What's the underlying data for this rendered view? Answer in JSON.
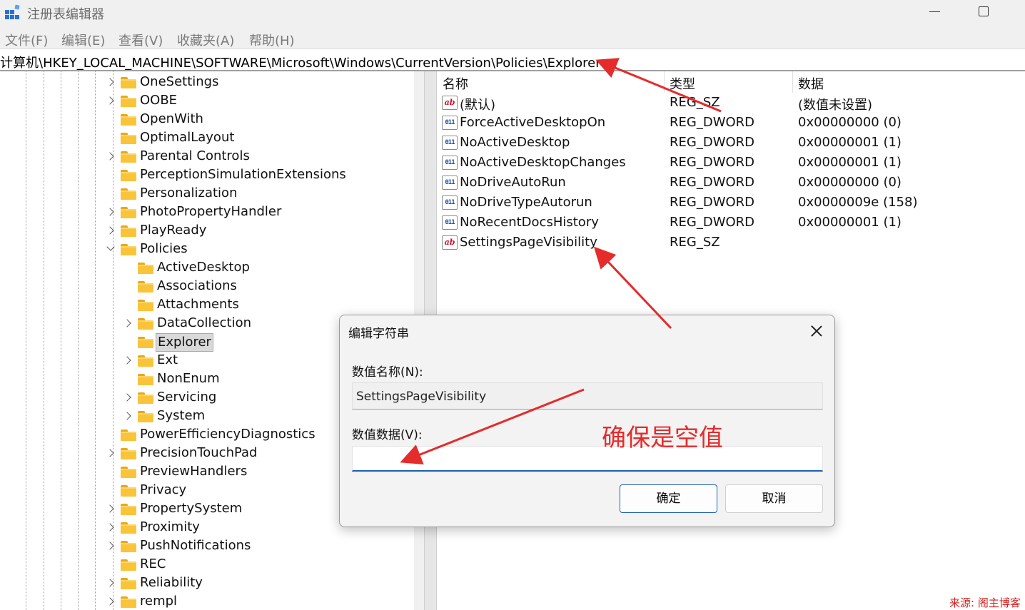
{
  "window": {
    "title": "注册表编辑器",
    "icon": "registry-editor-icon"
  },
  "menu": [
    "文件(F)",
    "编辑(E)",
    "查看(V)",
    "收藏夹(A)",
    "帮助(H)"
  ],
  "address": "计算机\\HKEY_LOCAL_MACHINE\\SOFTWARE\\Microsoft\\Windows\\CurrentVersion\\Policies\\Explorer",
  "tree": {
    "items": [
      {
        "label": "OneSettings",
        "expander": "right"
      },
      {
        "label": "OOBE",
        "expander": "right"
      },
      {
        "label": "OpenWith",
        "expander": "none"
      },
      {
        "label": "OptimalLayout",
        "expander": "none"
      },
      {
        "label": "Parental Controls",
        "expander": "right"
      },
      {
        "label": "PerceptionSimulationExtensions",
        "expander": "none"
      },
      {
        "label": "Personalization",
        "expander": "none"
      },
      {
        "label": "PhotoPropertyHandler",
        "expander": "right"
      },
      {
        "label": "PlayReady",
        "expander": "right"
      },
      {
        "label": "Policies",
        "expander": "down"
      },
      {
        "label": "ActiveDesktop",
        "expander": "none",
        "child": true
      },
      {
        "label": "Associations",
        "expander": "none",
        "child": true
      },
      {
        "label": "Attachments",
        "expander": "none",
        "child": true
      },
      {
        "label": "DataCollection",
        "expander": "right",
        "child": true
      },
      {
        "label": "Explorer",
        "expander": "none",
        "child": true,
        "selected": true
      },
      {
        "label": "Ext",
        "expander": "right",
        "child": true
      },
      {
        "label": "NonEnum",
        "expander": "none",
        "child": true
      },
      {
        "label": "Servicing",
        "expander": "right",
        "child": true
      },
      {
        "label": "System",
        "expander": "right",
        "child": true
      },
      {
        "label": "PowerEfficiencyDiagnostics",
        "expander": "none"
      },
      {
        "label": "PrecisionTouchPad",
        "expander": "right"
      },
      {
        "label": "PreviewHandlers",
        "expander": "none"
      },
      {
        "label": "Privacy",
        "expander": "none"
      },
      {
        "label": "PropertySystem",
        "expander": "right"
      },
      {
        "label": "Proximity",
        "expander": "right"
      },
      {
        "label": "PushNotifications",
        "expander": "right"
      },
      {
        "label": "REC",
        "expander": "none"
      },
      {
        "label": "Reliability",
        "expander": "right"
      },
      {
        "label": "rempl",
        "expander": "right"
      }
    ]
  },
  "values": {
    "headers": {
      "name": "名称",
      "type": "类型",
      "data": "数据"
    },
    "rows": [
      {
        "icon": "sz",
        "name": "(默认)",
        "type": "REG_SZ",
        "data": "(数值未设置)"
      },
      {
        "icon": "dword",
        "name": "ForceActiveDesktopOn",
        "type": "REG_DWORD",
        "data": "0x00000000 (0)"
      },
      {
        "icon": "dword",
        "name": "NoActiveDesktop",
        "type": "REG_DWORD",
        "data": "0x00000001 (1)"
      },
      {
        "icon": "dword",
        "name": "NoActiveDesktopChanges",
        "type": "REG_DWORD",
        "data": "0x00000001 (1)"
      },
      {
        "icon": "dword",
        "name": "NoDriveAutoRun",
        "type": "REG_DWORD",
        "data": "0x00000000 (0)"
      },
      {
        "icon": "dword",
        "name": "NoDriveTypeAutorun",
        "type": "REG_DWORD",
        "data": "0x0000009e (158)"
      },
      {
        "icon": "dword",
        "name": "NoRecentDocsHistory",
        "type": "REG_DWORD",
        "data": "0x00000001 (1)"
      },
      {
        "icon": "sz",
        "name": "SettingsPageVisibility",
        "type": "REG_SZ",
        "data": ""
      }
    ]
  },
  "dialog": {
    "title": "编辑字符串",
    "name_label": "数值名称(N):",
    "name_value": "SettingsPageVisibility",
    "data_label": "数值数据(V):",
    "data_value": "",
    "annotation": "确保是空值",
    "ok": "确定",
    "cancel": "取消"
  },
  "watermark": "来源: 阁主博客",
  "colors": {
    "accent": "#1a5fb4",
    "annotation": "#e52b2b",
    "folder": "#f9c43a"
  }
}
